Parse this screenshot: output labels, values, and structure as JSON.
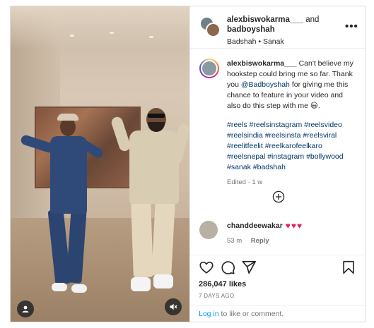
{
  "post": {
    "header": {
      "user1": "alexbiswokarma___",
      "and": "and",
      "user2": "badboyshah",
      "audio": "Badshah • Sanak",
      "more_label": "•••"
    },
    "caption": {
      "username": "alexbiswokarma___",
      "text_part1": "Can't believe my hookstep could bring me so far. Thank you",
      "mention": "@Badboyshah",
      "text_part2": "for giving me this chance to feature in your video and also do this step with me",
      "emoji": "😃",
      "text_end": ".",
      "hashtags": "#reels #reelsinstagram #reelsvideo #reelsindia #reelsinsta #reelsviral #reelitfeelit #reelkarofeelkaro #reelsnepal #instagram #bollywood #sanak #badshah",
      "edited": "Edited · 1 w"
    },
    "comment": {
      "username": "chanddeewakar",
      "hearts": [
        "♥",
        "♥",
        "♥"
      ],
      "time": "53 m",
      "reply": "Reply"
    },
    "likes": "286,047 likes",
    "date": "7 DAYS AGO",
    "login": {
      "link": "Log in",
      "text": "to like or comment."
    }
  },
  "icons": {
    "user": "user-icon",
    "mute": "mute-icon",
    "more": "more-icon",
    "add": "add-comment-icon",
    "like": "heart-icon",
    "comment": "comment-icon",
    "share": "share-icon",
    "save": "bookmark-icon"
  },
  "colors": {
    "link": "#0095f6",
    "hashtag": "#00376b",
    "muted": "#737373",
    "heart": "#e0245e"
  }
}
